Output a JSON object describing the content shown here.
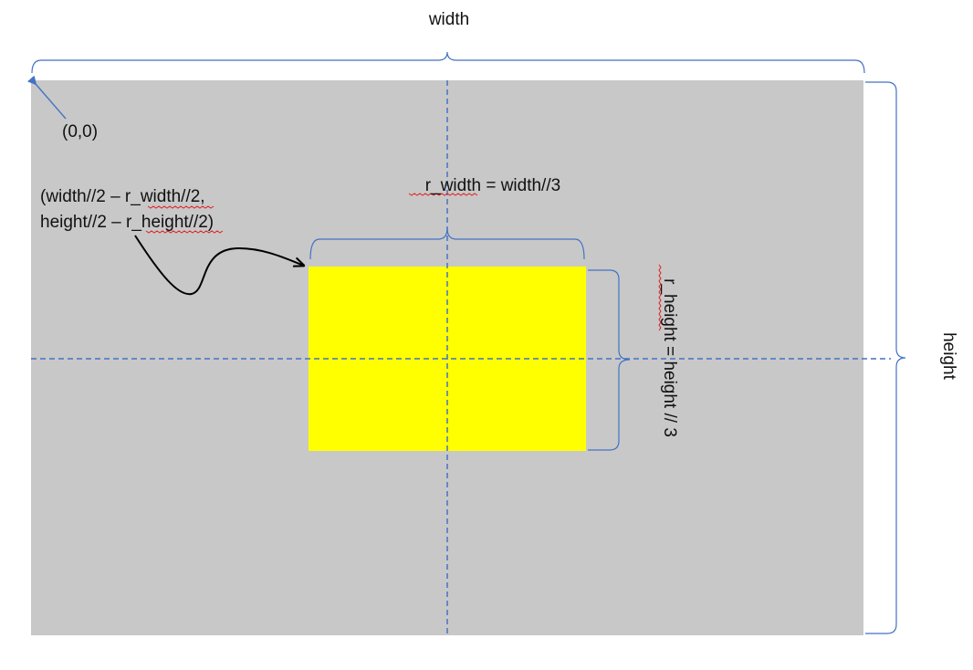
{
  "labels": {
    "width": "width",
    "height": "height",
    "origin": "(0,0)",
    "corner_line1": "(width//2 – r_width//2,",
    "corner_line2": "height//2 – r_height//2)",
    "r_width": "r_width = width//3",
    "r_height": "r_height = height // 3"
  },
  "colors": {
    "canvas": "#c8c8c8",
    "rect": "#ffff00",
    "bracket": "#4472c4",
    "center_line": "#4472c4",
    "arrow": "#000000",
    "spell_squiggle": "#e02020"
  }
}
